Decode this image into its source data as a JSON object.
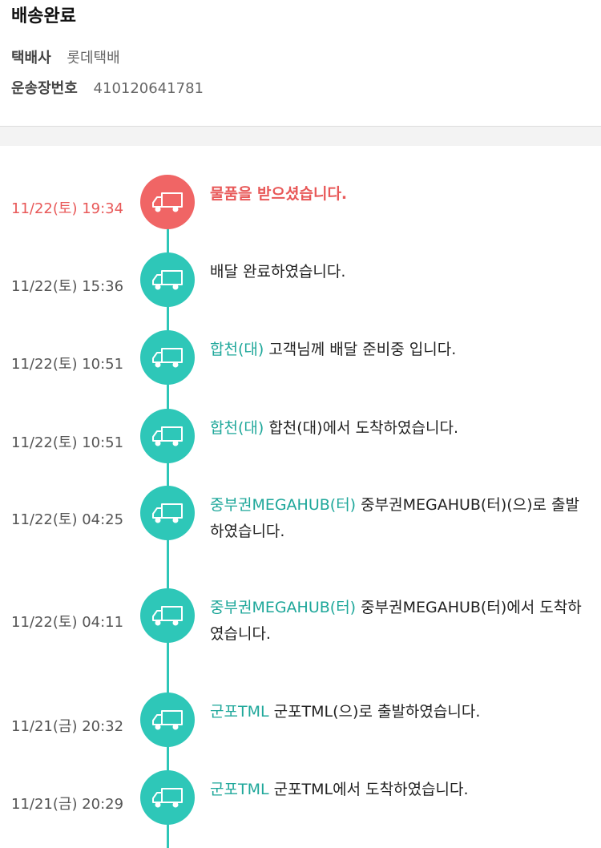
{
  "header": {
    "status": "배송완료",
    "carrier_label": "택배사",
    "carrier_value": "롯데택배",
    "tracking_label": "운송장번호",
    "tracking_value": "410120641781"
  },
  "events": [
    {
      "time": "11/22(토) 19:34",
      "location": "",
      "message": "물품을 받으셨습니다.",
      "icon": "truck-icon"
    },
    {
      "time": "11/22(토) 15:36",
      "location": "",
      "message": "배달 완료하였습니다.",
      "icon": "truck-icon"
    },
    {
      "time": "11/22(토) 10:51",
      "location": "합천(대)",
      "message": "고객님께 배달 준비중 입니다.",
      "icon": "truck-icon"
    },
    {
      "time": "11/22(토) 10:51",
      "location": "합천(대)",
      "message": "합천(대)에서 도착하였습니다.",
      "icon": "truck-icon"
    },
    {
      "time": "11/22(토) 04:25",
      "location": "중부권MEGAHUB(터)",
      "message": "중부권MEGAHUB(터)(으)로 출발하였습니다.",
      "icon": "truck-icon"
    },
    {
      "time": "11/22(토) 04:11",
      "location": "중부권MEGAHUB(터)",
      "message": "중부권MEGAHUB(터)에서 도착하였습니다.",
      "icon": "truck-icon"
    },
    {
      "time": "11/21(금) 20:32",
      "location": "군포TML",
      "message": "군포TML(으)로 출발하였습니다.",
      "icon": "truck-icon"
    },
    {
      "time": "11/21(금) 20:29",
      "location": "군포TML",
      "message": "군포TML에서 도착하였습니다.",
      "icon": "truck-icon"
    }
  ],
  "colors": {
    "accent": "#2ec7b8",
    "location_text": "#1ea79a",
    "latest": "#f06565",
    "latest_text": "#e85858"
  }
}
